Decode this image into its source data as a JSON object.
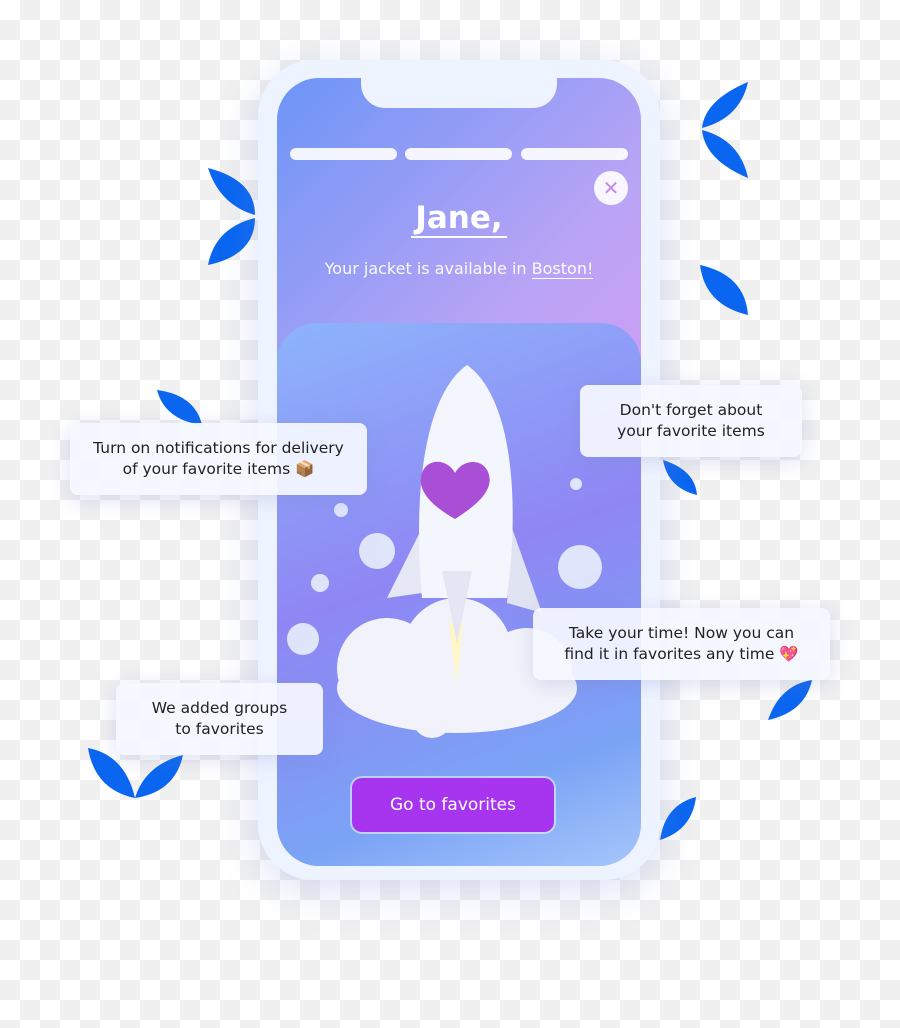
{
  "screen": {
    "progress_segments": 3,
    "close_icon": "close-icon",
    "title": "Jane,",
    "subtitle_prefix": "Your jacket is available in ",
    "subtitle_city": "Boston!",
    "cta_label": "Go to favorites"
  },
  "bubbles": [
    {
      "line1": "Turn on notifications for delivery",
      "line2": "of your favorite items 📦"
    },
    {
      "line1": "Don't forget about",
      "line2": "your favorite items"
    },
    {
      "line1": "Take your time! Now you can",
      "line2": "find it in favorites any time 💖"
    },
    {
      "line1": "We added groups",
      "line2": "to favorites"
    }
  ],
  "colors": {
    "accent": "#a735ef",
    "leaf": "#0a66f0",
    "heart": "#a84fd6"
  }
}
